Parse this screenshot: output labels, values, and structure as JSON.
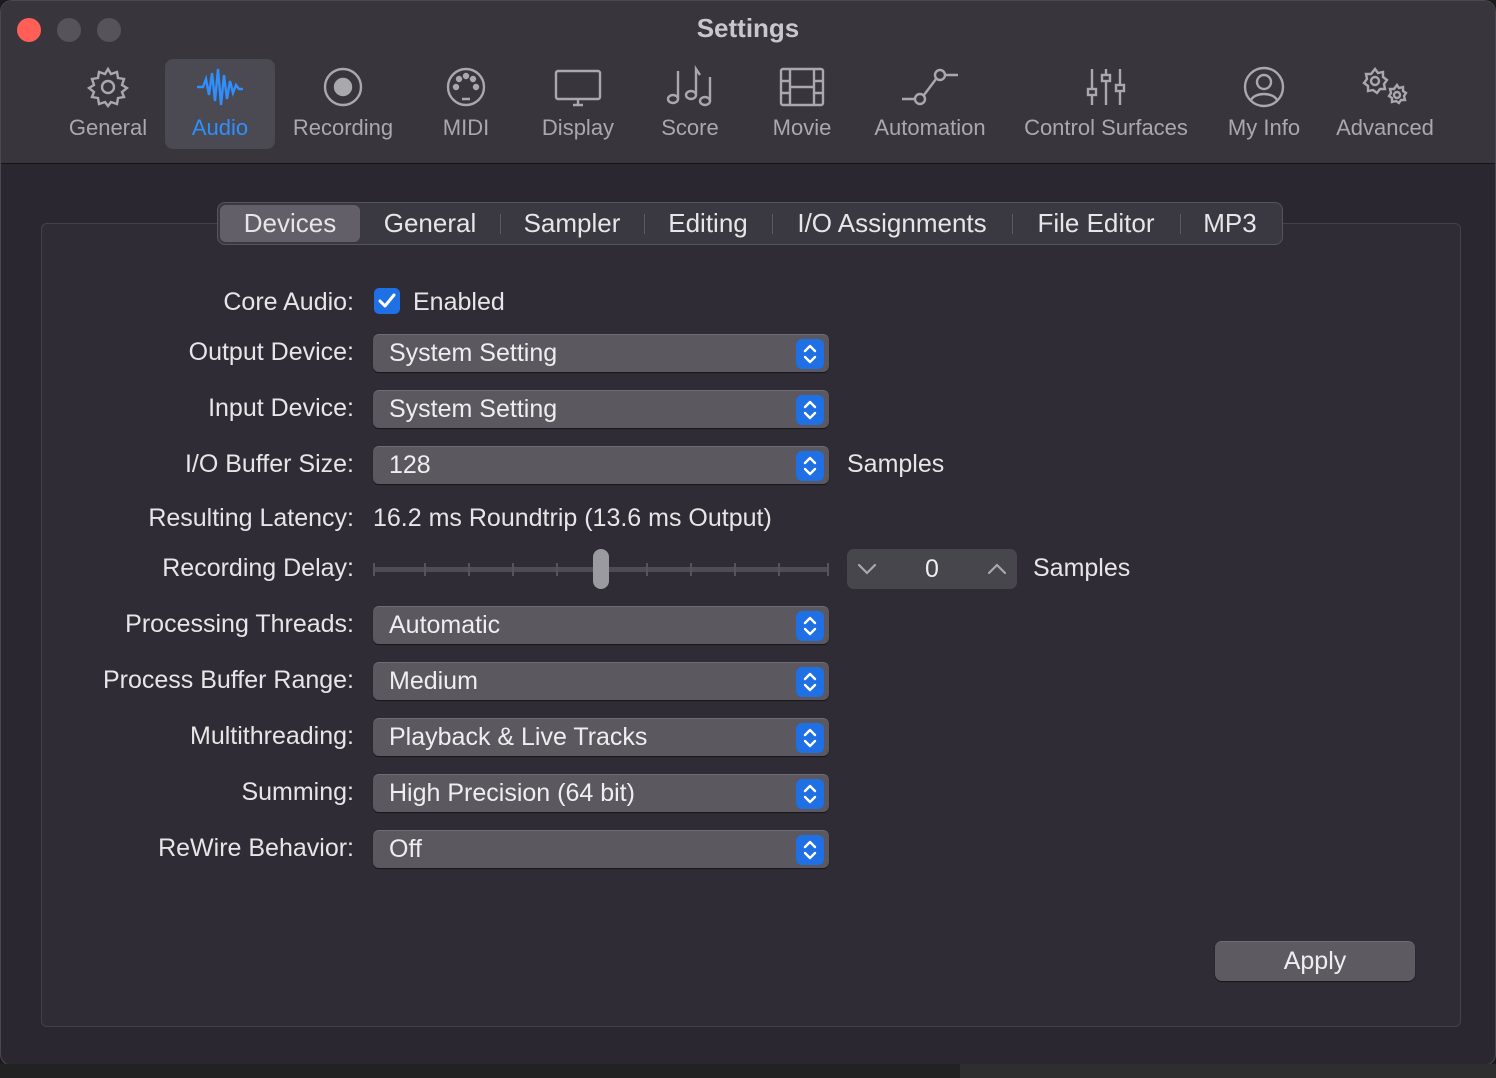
{
  "window": {
    "title": "Settings"
  },
  "toolbar": [
    {
      "label": "General",
      "icon": "gear-icon"
    },
    {
      "label": "Audio",
      "icon": "waveform-icon"
    },
    {
      "label": "Recording",
      "icon": "record-icon"
    },
    {
      "label": "MIDI",
      "icon": "midi-port-icon"
    },
    {
      "label": "Display",
      "icon": "display-icon"
    },
    {
      "label": "Score",
      "icon": "music-notes-icon"
    },
    {
      "label": "Movie",
      "icon": "film-icon"
    },
    {
      "label": "Automation",
      "icon": "automation-curve-icon"
    },
    {
      "label": "Control Surfaces",
      "icon": "sliders-icon"
    },
    {
      "label": "My Info",
      "icon": "user-circle-icon"
    },
    {
      "label": "Advanced",
      "icon": "gears-icon"
    }
  ],
  "tabs": [
    "Devices",
    "General",
    "Sampler",
    "Editing",
    "I/O Assignments",
    "File Editor",
    "MP3"
  ],
  "form": {
    "core_audio_label": "Core Audio:",
    "core_audio_value": "Enabled",
    "output_device_label": "Output Device:",
    "output_device_value": "System Setting",
    "input_device_label": "Input Device:",
    "input_device_value": "System Setting",
    "buffer_label": "I/O Buffer Size:",
    "buffer_value": "128",
    "buffer_unit": "Samples",
    "latency_label": "Resulting Latency:",
    "latency_value": "16.2 ms Roundtrip (13.6 ms Output)",
    "delay_label": "Recording Delay:",
    "delay_value": "0",
    "delay_unit": "Samples",
    "threads_label": "Processing Threads:",
    "threads_value": "Automatic",
    "buffer_range_label": "Process Buffer Range:",
    "buffer_range_value": "Medium",
    "multithreading_label": "Multithreading:",
    "multithreading_value": "Playback & Live Tracks",
    "summing_label": "Summing:",
    "summing_value": "High Precision (64 bit)",
    "rewire_label": "ReWire Behavior:",
    "rewire_value": "Off"
  },
  "apply_label": "Apply",
  "colors": {
    "accent": "#1f6fe5",
    "active_tab_text": "#2f8fff",
    "close": "#ff5f57"
  }
}
